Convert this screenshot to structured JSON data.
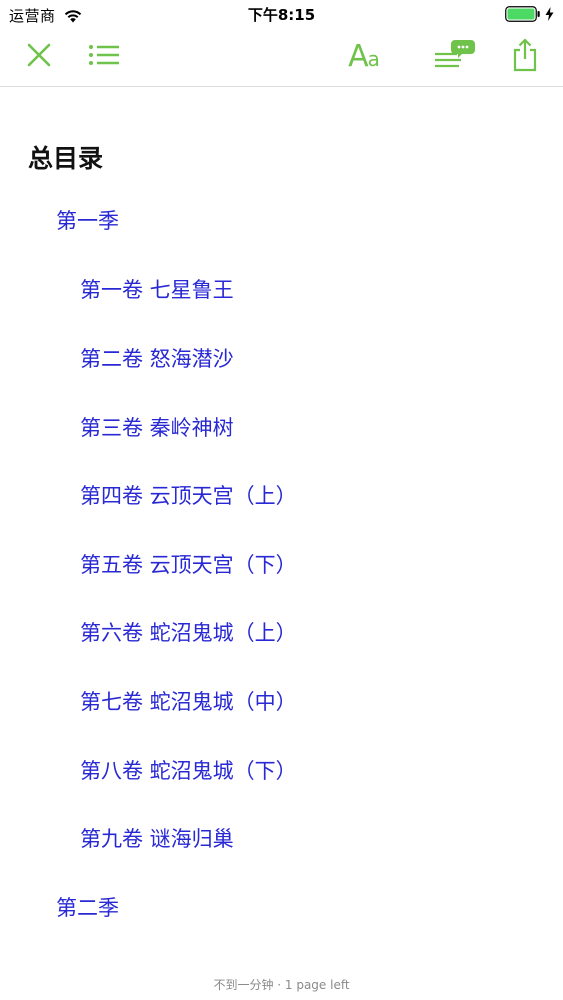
{
  "status_bar": {
    "carrier": "运营商",
    "time": "下午8:15"
  },
  "toolbar": {
    "font_big": "A",
    "font_small": "a",
    "accent_color": "#6fc24a"
  },
  "toc": {
    "title": "总目录",
    "entries": [
      {
        "label": "第一季",
        "level": "season"
      },
      {
        "label": "第一卷 七星鲁王",
        "level": "volume"
      },
      {
        "label": "第二卷 怒海潜沙",
        "level": "volume"
      },
      {
        "label": "第三卷 秦岭神树",
        "level": "volume"
      },
      {
        "label": "第四卷 云顶天宫（上）",
        "level": "volume"
      },
      {
        "label": "第五卷 云顶天宫（下）",
        "level": "volume"
      },
      {
        "label": "第六卷 蛇沼鬼城（上）",
        "level": "volume"
      },
      {
        "label": "第七卷 蛇沼鬼城（中）",
        "level": "volume"
      },
      {
        "label": "第八卷 蛇沼鬼城（下）",
        "level": "volume"
      },
      {
        "label": "第九卷 谜海归巢",
        "level": "volume"
      },
      {
        "label": "第二季",
        "level": "season"
      }
    ],
    "link_color": "#2828d4"
  },
  "footer": {
    "reading_status": "不到一分钟 · 1 page left"
  }
}
